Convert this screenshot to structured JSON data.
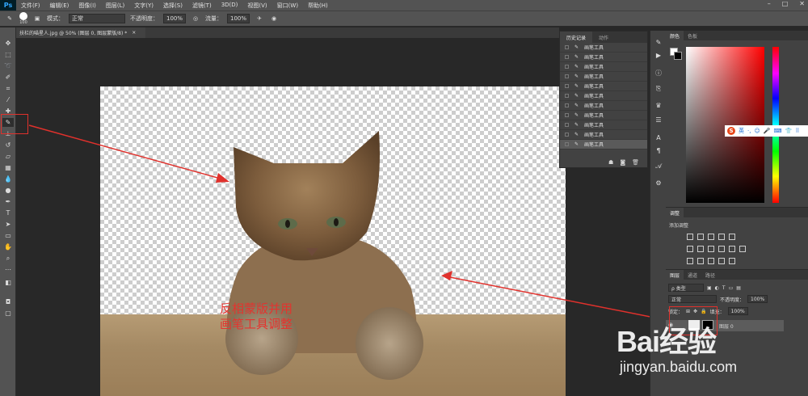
{
  "app": {
    "logo": "Ps"
  },
  "menubar": {
    "items": [
      "文件(F)",
      "编辑(E)",
      "图像(I)",
      "图层(L)",
      "文字(Y)",
      "选择(S)",
      "滤镜(T)",
      "3D(D)",
      "视图(V)",
      "窗口(W)",
      "帮助(H)"
    ]
  },
  "options": {
    "brush_size": "100",
    "mode_label": "模式：",
    "mode_value": "正常",
    "opacity_label": "不透明度：",
    "opacity_value": "100%",
    "flow_label": "流量：",
    "flow_value": "100%"
  },
  "document": {
    "tab_title": "扶栏的喵星人.jpg @ 50% (图层 0, 图层蒙版/8) *",
    "close_glyph": "×"
  },
  "canvas": {
    "annotation_line1": "反相蒙版并用",
    "annotation_line2": "画笔工具调整",
    "annotation_color": "#e3342f"
  },
  "history": {
    "tabs": [
      "历史记录",
      "动作"
    ],
    "items": [
      "画笔工具",
      "画笔工具",
      "画笔工具",
      "画笔工具",
      "画笔工具",
      "画笔工具",
      "画笔工具",
      "画笔工具",
      "画笔工具",
      "画笔工具",
      "画笔工具"
    ]
  },
  "color_panel": {
    "tabs": [
      "颜色",
      "色板"
    ]
  },
  "adjust_panel": {
    "title": "调整",
    "subtitle": "添加调整"
  },
  "layers_panel": {
    "tabs": [
      "图层",
      "通道",
      "路径"
    ],
    "filter_label": "ρ 类型",
    "blend_mode": "正常",
    "opacity_label": "不透明度：",
    "opacity_value": "100%",
    "lock_label": "锁定：",
    "fill_label": "填充：",
    "fill_value": "100%",
    "layer_name": "图层 0"
  },
  "ime": {
    "logo": "S",
    "label": "英"
  },
  "watermark": {
    "brand": "Bai经验",
    "url": "jingyan.baidu.com"
  }
}
